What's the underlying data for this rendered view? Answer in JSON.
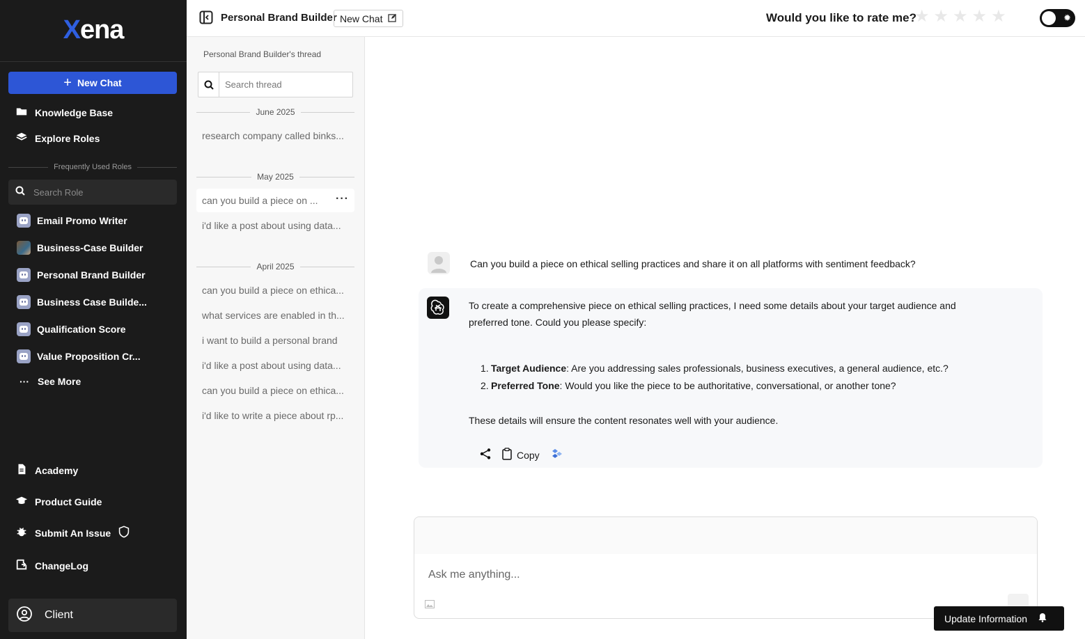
{
  "app": {
    "logo_x": "X",
    "logo_rest": "ena"
  },
  "sidebar": {
    "new_chat_label": "New Chat",
    "links": [
      {
        "label": "Knowledge Base",
        "icon": "folder-icon"
      },
      {
        "label": "Explore Roles",
        "icon": "layers-icon"
      }
    ],
    "frequent_label": "Frequently Used Roles",
    "search_placeholder": "Search Role",
    "roles": [
      {
        "label": "Email Promo Writer",
        "avatar": "bot"
      },
      {
        "label": "Business-Case Builder",
        "avatar": "photo"
      },
      {
        "label": "Personal Brand Builder",
        "avatar": "bot"
      },
      {
        "label": "Business Case Builde...",
        "avatar": "bot"
      },
      {
        "label": "Qualification Score",
        "avatar": "bot"
      },
      {
        "label": "Value Proposition Cr...",
        "avatar": "bot"
      }
    ],
    "see_more": "See More",
    "bottom_links": [
      {
        "label": "Academy",
        "icon": "document-icon"
      },
      {
        "label": "Product Guide",
        "icon": "graduation-cap-icon"
      },
      {
        "label": "Submit An Issue",
        "icon": "bug-icon"
      },
      {
        "label": "ChangeLog",
        "icon": "changelog-icon"
      }
    ],
    "client_label": "Client"
  },
  "topbar": {
    "title": "Personal Brand Builder",
    "new_chat_label": "New Chat",
    "rate_prompt": "Would you like to rate me?",
    "rating": 0,
    "max_rating": 5
  },
  "thread_panel": {
    "heading": "Personal Brand Builder's thread",
    "search_placeholder": "Search thread",
    "groups": [
      {
        "date": "June 2025",
        "items": [
          "research company called binks..."
        ]
      },
      {
        "date": "May 2025",
        "items": [
          "can you build a piece on ...",
          "i'd like a post about using data..."
        ]
      },
      {
        "date": "April 2025",
        "items": [
          "can you build a piece on ethica...",
          "what services are enabled in th...",
          "i want to build a personal brand",
          "i'd like a post about using data...",
          "can you build a piece on ethica...",
          "i'd like to write a piece about rp..."
        ]
      }
    ]
  },
  "chat": {
    "user_message": "Can you build a piece on ethical selling practices and share it on all platforms with sentiment feedback?",
    "bot_intro": "To create a comprehensive piece on ethical selling practices, I need some details about your target audience and preferred tone. Could you please specify:",
    "bot_list": [
      {
        "num": "1.",
        "bold": "Target Audience",
        "text": ": Are you addressing sales professionals, business executives, a general audience, etc.?"
      },
      {
        "num": "2.",
        "bold": "Preferred Tone",
        "text": ": Would you like the piece to be authoritative, conversational, or another tone?"
      }
    ],
    "bot_closing": "These details will ensure the content resonates well with your audience.",
    "copy_label": "Copy"
  },
  "composer": {
    "placeholder": "Ask me anything..."
  },
  "update_info_label": "Update Information",
  "colors": {
    "sidebar_bg": "#1b1b1b",
    "accent": "#2d56d6",
    "logo_x": "#2f5fe0"
  }
}
